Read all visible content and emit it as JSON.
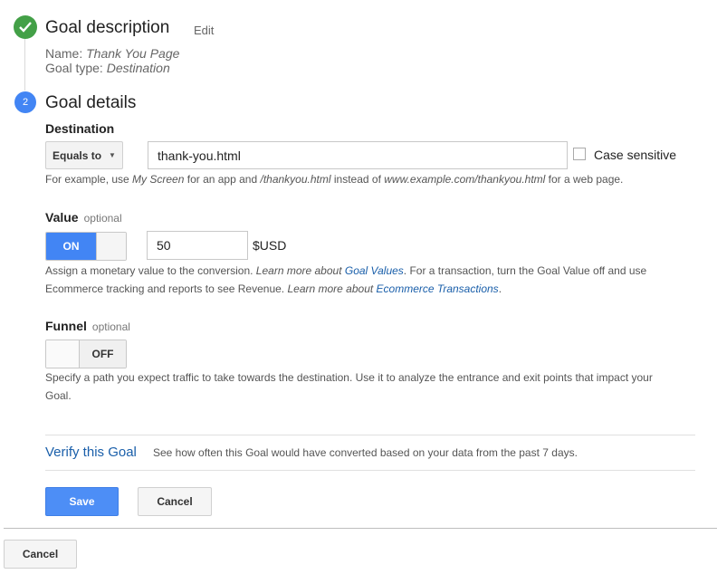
{
  "step1": {
    "title": "Goal description",
    "edit_label": "Edit",
    "name_prefix": "Name: ",
    "name_value": "Thank You Page",
    "type_prefix": "Goal type: ",
    "type_value": "Destination"
  },
  "step2": {
    "number": "2",
    "title": "Goal details"
  },
  "destination": {
    "label": "Destination",
    "match_type": "Equals to",
    "value": "thank-you.html",
    "case_sensitive_label": "Case sensitive",
    "help": {
      "p1": "For example, use ",
      "i1": "My Screen",
      "p2": " for an app and ",
      "i2": "/thankyou.html",
      "p3": " instead of ",
      "i3": "www.example.com/thankyou.html",
      "p4": " for a web page."
    }
  },
  "value": {
    "label": "Value",
    "optional": "optional",
    "toggle_label": "ON",
    "amount": "50",
    "currency": "$USD",
    "help": {
      "p1": "Assign a monetary value to the conversion. ",
      "i1": "Learn more about ",
      "link1": "Goal Values",
      "p2": ". For a transaction, turn the Goal Value off and use",
      "p3": "Ecommerce tracking and reports to see Revenue. ",
      "i2": "Learn more about ",
      "link2": "Ecommerce Transactions",
      "p4": "."
    }
  },
  "funnel": {
    "label": "Funnel",
    "optional": "optional",
    "toggle_label": "OFF",
    "help_line1": "Specify a path you expect traffic to take towards the destination. Use it to analyze the entrance and exit points that impact your",
    "help_line2": "Goal."
  },
  "verify": {
    "link": "Verify this Goal",
    "text": "See how often this Goal would have converted based on your data from the past 7 days."
  },
  "buttons": {
    "save": "Save",
    "cancel": "Cancel",
    "bottom_cancel": "Cancel"
  },
  "colors": {
    "accent": "#4285f4",
    "success": "#43a047",
    "link": "#1a5faa"
  }
}
